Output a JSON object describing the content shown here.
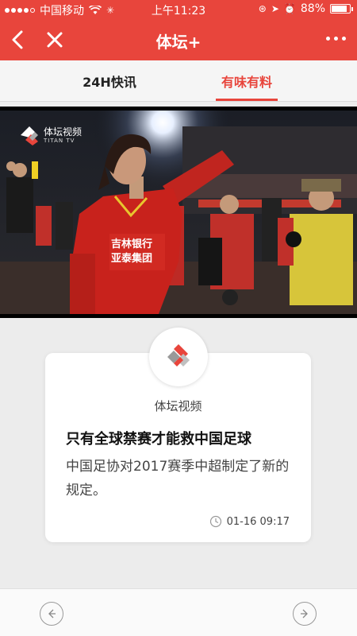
{
  "status_bar": {
    "carrier": "中国移动",
    "time": "上午11:23",
    "battery": "88%",
    "battery_level": 0.88
  },
  "nav": {
    "title": "体坛+"
  },
  "tabs": [
    {
      "label": "24H快讯",
      "active": false
    },
    {
      "label": "有味有料",
      "active": true
    }
  ],
  "video": {
    "logo_text": "体坛视频",
    "logo_sub": "TITAN TV"
  },
  "article": {
    "source": "体坛视频",
    "headline": "只有全球禁赛才能救中国足球",
    "summary": "中国足协对2017赛季中超制定了新的规定。",
    "time": "01-16 09:17"
  },
  "colors": {
    "brand": "#e8453c",
    "background": "#ececec"
  },
  "icons": [
    "back-icon",
    "close-icon",
    "more-icon",
    "wifi-icon",
    "clock-icon",
    "prev-arrow-icon",
    "next-arrow-icon"
  ]
}
